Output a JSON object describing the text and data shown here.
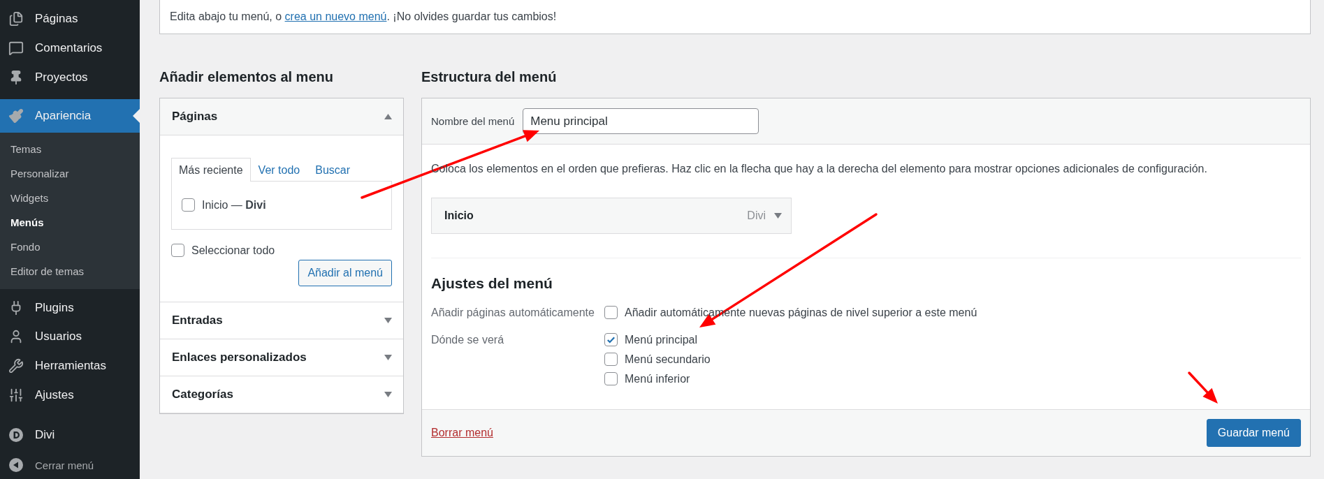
{
  "sidebar": {
    "items": [
      {
        "label": "Páginas",
        "selected": false
      },
      {
        "label": "Comentarios",
        "selected": false
      },
      {
        "label": "Proyectos",
        "selected": false
      },
      {
        "label": "Apariencia",
        "selected": true,
        "children": [
          {
            "label": "Temas",
            "selected": false
          },
          {
            "label": "Personalizar",
            "selected": false
          },
          {
            "label": "Widgets",
            "selected": false
          },
          {
            "label": "Menús",
            "selected": true
          },
          {
            "label": "Fondo",
            "selected": false
          },
          {
            "label": "Editor de temas",
            "selected": false
          }
        ]
      },
      {
        "label": "Plugins",
        "selected": false
      },
      {
        "label": "Usuarios",
        "selected": false
      },
      {
        "label": "Herramientas",
        "selected": false
      },
      {
        "label": "Ajustes",
        "selected": false
      },
      {
        "label": "Divi",
        "selected": false
      }
    ],
    "collapse_label": "Cerrar menú"
  },
  "notice": {
    "before": "Edita abajo tu menú, o ",
    "link": "crea un nuevo menú",
    "after": ". ¡No olvides guardar tus cambios!"
  },
  "add_items": {
    "heading": "Añadir elementos al menu",
    "sections": [
      {
        "title": "Páginas",
        "expanded": true,
        "tabs": [
          {
            "label": "Más reciente",
            "selected": true
          },
          {
            "label": "Ver todo",
            "selected": false
          },
          {
            "label": "Buscar",
            "selected": false
          }
        ],
        "items": [
          {
            "label": "Inicio — **Divi**",
            "checked": false
          }
        ],
        "select_all": {
          "label": "Seleccionar todo",
          "checked": false
        },
        "button": "Añadir al menú"
      },
      {
        "title": "Entradas",
        "expanded": false
      },
      {
        "title": "Enlaces personalizados",
        "expanded": false
      },
      {
        "title": "Categorías",
        "expanded": false
      }
    ]
  },
  "structure": {
    "heading": "Estructura del menú",
    "name_label": "Nombre del menú",
    "name_value": "Menu principal",
    "instructions": "Coloca los elementos en el orden que prefieras. Haz clic en la flecha que hay a la derecha del elemento para mostrar opciones adicionales de configuración.",
    "menu_items": [
      {
        "title": "Inicio",
        "type": "Divi"
      }
    ],
    "settings": {
      "heading": "Ajustes del menú",
      "rows": [
        {
          "label": "Añadir páginas automáticamente",
          "options": [
            {
              "label": "Añadir automáticamente nuevas páginas de nivel superior a este menú",
              "checked": false
            }
          ]
        },
        {
          "label": "Dónde se verá",
          "options": [
            {
              "label": "Menú principal",
              "checked": true
            },
            {
              "label": "Menú secundario",
              "checked": false
            },
            {
              "label": "Menú inferior",
              "checked": false
            }
          ]
        }
      ]
    },
    "delete_link": "Borrar menú",
    "save_button": "Guardar menú"
  }
}
